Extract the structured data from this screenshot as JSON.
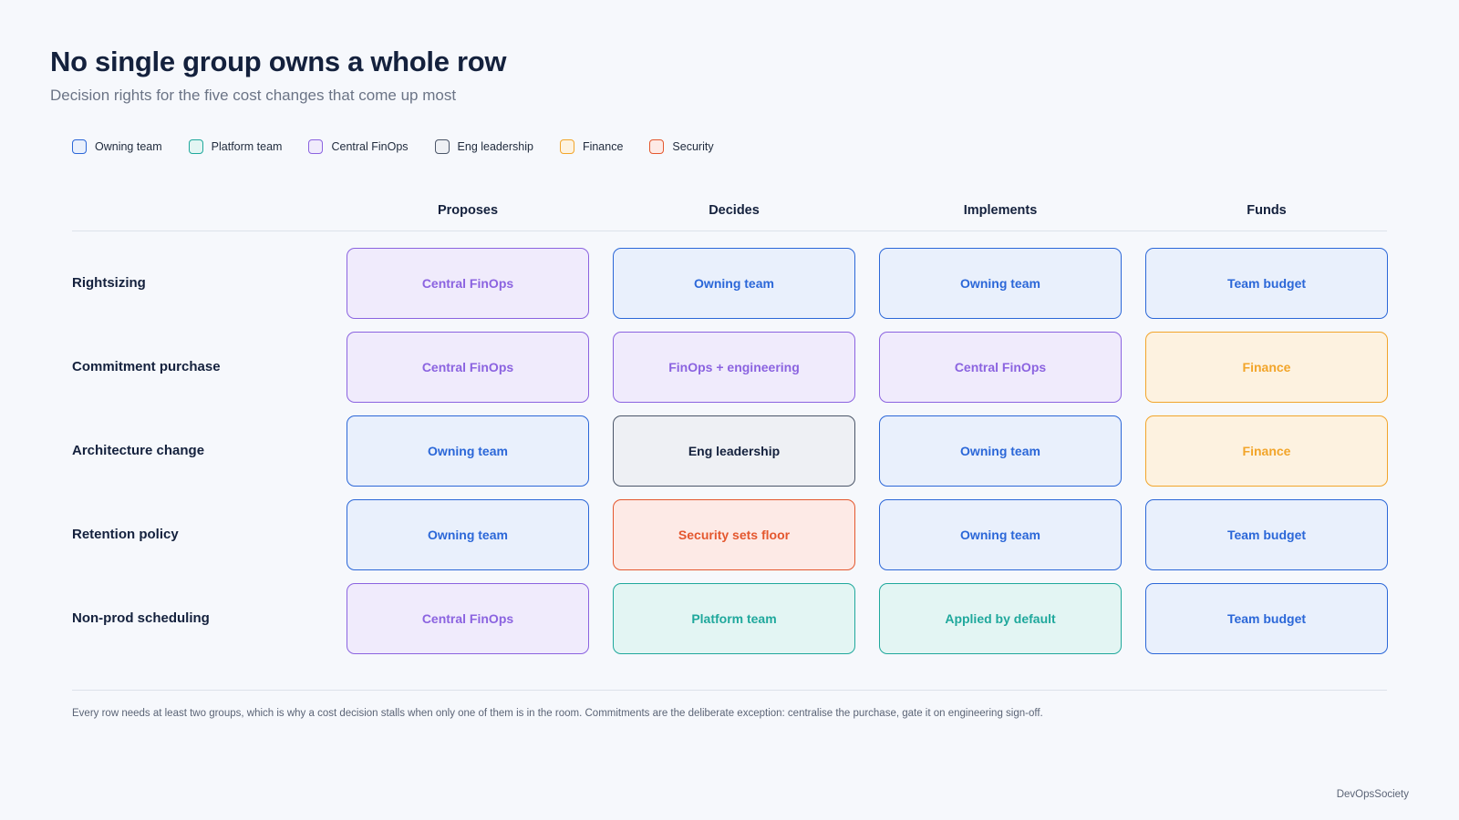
{
  "title": "No single group owns a whole row",
  "subtitle": "Decision rights for the five cost changes that come up most",
  "legend": [
    {
      "label": "Owning team",
      "color": "#2b67d8",
      "fill": "#e9f0fc"
    },
    {
      "label": "Platform team",
      "color": "#1fa89c",
      "fill": "#e3f5f3"
    },
    {
      "label": "Central FinOps",
      "color": "#8b63e0",
      "fill": "#f0ebfc"
    },
    {
      "label": "Eng leadership",
      "color": "#4a5568",
      "fill": "#eef0f4"
    },
    {
      "label": "Finance",
      "color": "#f2a52a",
      "fill": "#fdf2e0"
    },
    {
      "label": "Security",
      "color": "#e4572e",
      "fill": "#fdeae6"
    }
  ],
  "columns": [
    "Proposes",
    "Decides",
    "Implements",
    "Funds"
  ],
  "rows": [
    {
      "label": "Rightsizing",
      "cells": [
        {
          "text": "Central FinOps",
          "group": "Central FinOps"
        },
        {
          "text": "Owning team",
          "group": "Owning team"
        },
        {
          "text": "Owning team",
          "group": "Owning team"
        },
        {
          "text": "Team budget",
          "group": "Owning team"
        }
      ]
    },
    {
      "label": "Commitment purchase",
      "cells": [
        {
          "text": "Central FinOps",
          "group": "Central FinOps"
        },
        {
          "text": "FinOps + engineering",
          "group": "Central FinOps"
        },
        {
          "text": "Central FinOps",
          "group": "Central FinOps"
        },
        {
          "text": "Finance",
          "group": "Finance"
        }
      ]
    },
    {
      "label": "Architecture change",
      "cells": [
        {
          "text": "Owning team",
          "group": "Owning team"
        },
        {
          "text": "Eng leadership",
          "group": "Eng leadership"
        },
        {
          "text": "Owning team",
          "group": "Owning team"
        },
        {
          "text": "Finance",
          "group": "Finance"
        }
      ]
    },
    {
      "label": "Retention policy",
      "cells": [
        {
          "text": "Owning team",
          "group": "Owning team"
        },
        {
          "text": "Security sets floor",
          "group": "Security"
        },
        {
          "text": "Owning team",
          "group": "Owning team"
        },
        {
          "text": "Team budget",
          "group": "Owning team"
        }
      ]
    },
    {
      "label": "Non-prod scheduling",
      "cells": [
        {
          "text": "Central FinOps",
          "group": "Central FinOps"
        },
        {
          "text": "Platform team",
          "group": "Platform team"
        },
        {
          "text": "Applied by default",
          "group": "Platform team"
        },
        {
          "text": "Team budget",
          "group": "Owning team"
        }
      ]
    }
  ],
  "footnote": "Every row needs at least two groups, which is why a cost decision stalls when only one of them is in the room. Commitments are the deliberate exception: centralise the purchase, gate it on engineering sign-off.",
  "brand": "DevOpsSociety"
}
